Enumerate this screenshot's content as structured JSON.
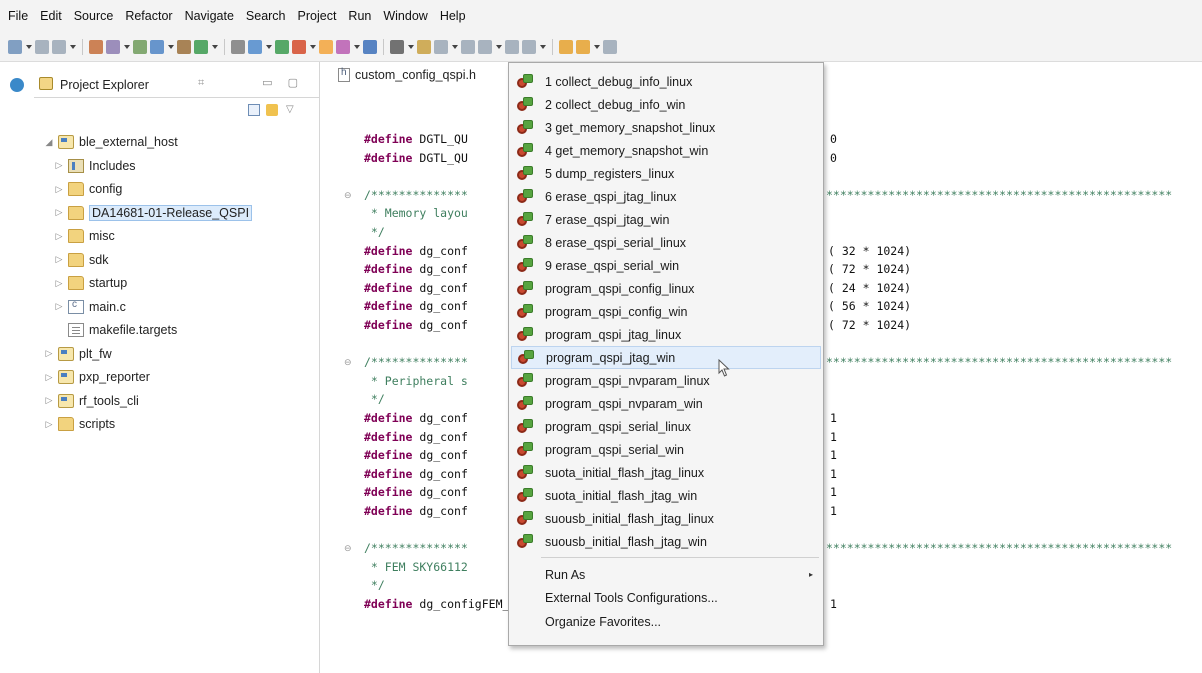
{
  "menubar": {
    "items": [
      "File",
      "Edit",
      "Source",
      "Refactor",
      "Navigate",
      "Search",
      "Project",
      "Run",
      "Window",
      "Help"
    ]
  },
  "explorer": {
    "title": "Project Explorer",
    "close_glyph": "⌗",
    "tree": [
      {
        "label": "ble_external_host",
        "icon": "project-folder-icon",
        "arrow": "◢",
        "selected": false
      },
      {
        "label": "Includes",
        "icon": "includes-icon",
        "arrow": "▷",
        "selected": false
      },
      {
        "label": "config",
        "icon": "folder-icon",
        "arrow": "▷",
        "selected": false
      },
      {
        "label": "DA14681-01-Release_QSPI",
        "icon": "folder-icon",
        "arrow": "▷",
        "selected": true
      },
      {
        "label": "misc",
        "icon": "folder-icon",
        "arrow": "▷",
        "selected": false
      },
      {
        "label": "sdk",
        "icon": "folder-icon",
        "arrow": "▷",
        "selected": false
      },
      {
        "label": "startup",
        "icon": "folder-icon",
        "arrow": "▷",
        "selected": false
      },
      {
        "label": "main.c",
        "icon": "c-file-icon",
        "arrow": "▷",
        "selected": false
      },
      {
        "label": "makefile.targets",
        "icon": "text-file-icon",
        "arrow": "",
        "selected": false
      },
      {
        "label": "plt_fw",
        "icon": "project-folder-icon",
        "arrow": "▷",
        "selected": false
      },
      {
        "label": "pxp_reporter",
        "icon": "project-folder-icon",
        "arrow": "▷",
        "selected": false
      },
      {
        "label": "rf_tools_cli",
        "icon": "project-folder-icon",
        "arrow": "▷",
        "selected": false
      },
      {
        "label": "scripts",
        "icon": "folder-icon",
        "arrow": "▷",
        "selected": false
      }
    ]
  },
  "editor": {
    "tab_label": "custom_config_qspi.h",
    "lines": [
      {
        "type": "define",
        "name": "DGTL_QU",
        "value": "0"
      },
      {
        "type": "define",
        "name": "DGTL_QU",
        "value": "0"
      },
      {
        "type": "blank"
      },
      {
        "type": "comment-start",
        "text": "/**************"
      },
      {
        "type": "comment",
        "text": " * Memory layou"
      },
      {
        "type": "comment",
        "text": " */"
      },
      {
        "type": "define",
        "name": "dg_conf",
        "value": "( 32 * 1024)"
      },
      {
        "type": "define",
        "name": "dg_conf",
        "value": "( 72 * 1024)"
      },
      {
        "type": "define",
        "name": "dg_conf",
        "value": "( 24 * 1024)"
      },
      {
        "type": "define",
        "name": "dg_conf",
        "value": "( 56 * 1024)"
      },
      {
        "type": "define",
        "name": "dg_conf",
        "value": "( 72 * 1024)"
      },
      {
        "type": "blank"
      },
      {
        "type": "comment-start",
        "text": "/**************"
      },
      {
        "type": "comment",
        "text": " * Peripheral s"
      },
      {
        "type": "comment",
        "text": " */"
      },
      {
        "type": "define",
        "name": "dg_conf",
        "value": "1"
      },
      {
        "type": "define",
        "name": "dg_conf",
        "value": "1"
      },
      {
        "type": "define",
        "name": "dg_conf",
        "value": "1"
      },
      {
        "type": "define",
        "name": "dg_conf",
        "value": "1"
      },
      {
        "type": "define",
        "name": "dg_conf",
        "value": "1"
      },
      {
        "type": "define",
        "name": "dg_conf",
        "value": "1"
      },
      {
        "type": "blank"
      },
      {
        "type": "comment-start",
        "text": "/**************"
      },
      {
        "type": "comment",
        "text": " * FEM SKY66112"
      },
      {
        "type": "comment",
        "text": " */"
      },
      {
        "type": "define",
        "name": "dg_configFEM_DLG_REF_BOARD",
        "value": "1"
      }
    ],
    "define_keyword": "#define",
    "comment_fill": "**************************************************"
  },
  "dropdown": {
    "tools": [
      "1 collect_debug_info_linux",
      "2 collect_debug_info_win",
      "3 get_memory_snapshot_linux",
      "4 get_memory_snapshot_win",
      "5 dump_registers_linux",
      "6 erase_qspi_jtag_linux",
      "7 erase_qspi_jtag_win",
      "8 erase_qspi_serial_linux",
      "9 erase_qspi_serial_win",
      "program_qspi_config_linux",
      "program_qspi_config_win",
      "program_qspi_jtag_linux",
      "program_qspi_jtag_win",
      "program_qspi_nvparam_linux",
      "program_qspi_nvparam_win",
      "program_qspi_serial_linux",
      "program_qspi_serial_win",
      "suota_initial_flash_jtag_linux",
      "suota_initial_flash_jtag_win",
      "suousb_initial_flash_jtag_linux",
      "suousb_initial_flash_jtag_win"
    ],
    "hovered_index": 12,
    "run_as": "Run As",
    "submenu_glyph": "▸",
    "configurations": "External Tools Configurations...",
    "organize": "Organize Favorites..."
  },
  "colors": {
    "keyword": "#7f0055",
    "comment": "#3f7f5f",
    "selection": "#dcebfb",
    "menu_hover": "#e3eefb"
  }
}
